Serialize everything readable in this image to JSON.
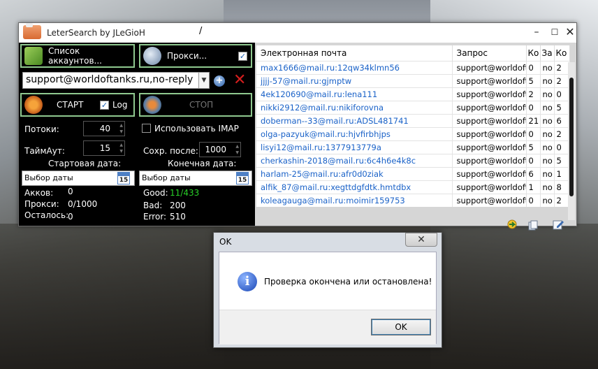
{
  "window": {
    "title": "LeterSearch by JLeGioH",
    "title_mark": "/"
  },
  "buttons": {
    "accounts": "Список аккаунтов...",
    "proxy": "Прокси...",
    "start": "СТАРТ",
    "log": "Log",
    "stop": "СТОП"
  },
  "query": {
    "value": "support@worldoftanks.ru,no-reply"
  },
  "settings": {
    "threads_label": "Потоки:",
    "threads_value": "40",
    "timeout_label": "ТаймАут:",
    "timeout_value": "15",
    "imap_label": "Использовать IMAP",
    "save_after_label": "Сохр. после:",
    "save_after_value": "1000",
    "start_date_label": "Стартовая дата:",
    "end_date_label": "Конечная дата:",
    "date_placeholder": "Выбор даты",
    "calendar_day": "15"
  },
  "stats": {
    "accs_label": "Акков:",
    "accs_value": "0",
    "proxy_label": "Прокси:",
    "proxy_value": "0/1000",
    "left_label": "Осталось:",
    "left_value": "0",
    "good_label": "Good:",
    "good_value": "11/433",
    "bad_label": "Bad:",
    "bad_value": "200",
    "error_label": "Error:",
    "error_value": "510"
  },
  "table": {
    "headers": [
      "Электронная почта",
      "Запрос",
      "Ко",
      "За",
      "Ко"
    ],
    "rows": [
      [
        "max1666@mail.ru:12qw34klmn56",
        "support@worldoft",
        "0",
        "no",
        "2"
      ],
      [
        "jjjj-57@mail.ru:gjmptw",
        "support@worldoft",
        "5",
        "no",
        "2"
      ],
      [
        "4ek120690@mail.ru:lena111",
        "support@worldoft",
        "2",
        "no",
        "0"
      ],
      [
        "nikki2912@mail.ru:nikiforovna",
        "support@worldoft",
        "0",
        "no",
        "5"
      ],
      [
        "doberman--33@mail.ru:ADSL481741",
        "support@worldoft",
        "21",
        "no",
        "6"
      ],
      [
        "olga-pazyuk@mail.ru:hjvfirbhjps",
        "support@worldoft",
        "0",
        "no",
        "2"
      ],
      [
        "lisyi12@mail.ru:1377913779a",
        "support@worldoft",
        "5",
        "no",
        "0"
      ],
      [
        "cherkashin-2018@mail.ru:6c4h6e4k8c",
        "support@worldoft",
        "0",
        "no",
        "5"
      ],
      [
        "harlam-25@mail.ru:afr0d0ziak",
        "support@worldoft",
        "6",
        "no",
        "1"
      ],
      [
        "alfik_87@mail.ru:xegttdgfdtk.hmtdbx",
        "support@worldoft",
        "1",
        "no",
        "8"
      ],
      [
        "koleagauga@mail.ru:moimir159753",
        "support@worldoft",
        "0",
        "no",
        "2"
      ]
    ]
  },
  "dialog": {
    "title": "OK",
    "message": "Проверка окончена или остановлена!",
    "ok_label": "OK"
  },
  "colors": {
    "accent_green": "#8fc88f",
    "good_green": "#28d028",
    "link_blue": "#1a62c8",
    "delete_red": "#d31e1e"
  }
}
